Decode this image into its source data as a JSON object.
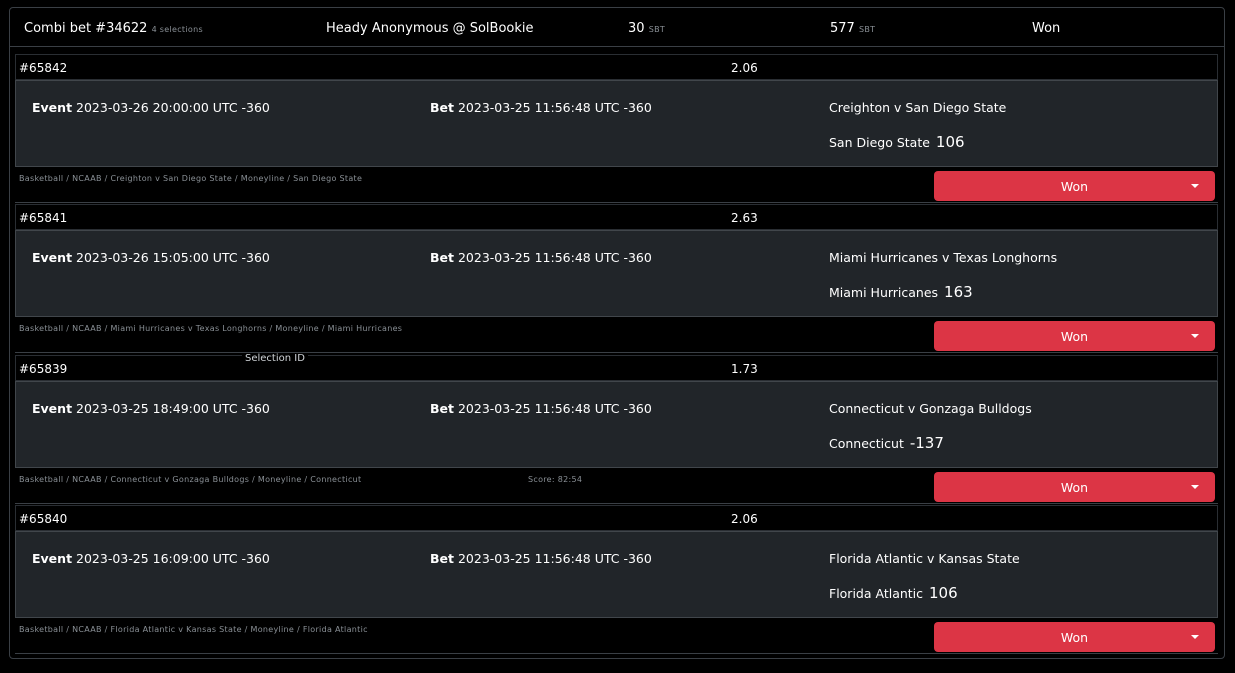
{
  "header": {
    "title": "Combi bet #34622",
    "selections_count": "4 selections",
    "user": "Heady Anonymous @ SolBookie",
    "stake": "30",
    "stake_unit": "SBT",
    "payout": "577",
    "payout_unit": "SBT",
    "status": "Won"
  },
  "tooltip": "Selection ID",
  "labels": {
    "event": "Event",
    "bet": "Bet"
  },
  "selections": [
    {
      "id": "#65842",
      "odds": "2.06",
      "event_time": "2023-03-26 20:00:00 UTC -360",
      "bet_time": "2023-03-25 11:56:48 UTC -360",
      "match": "Creighton v San Diego State",
      "pick": "San Diego State",
      "line": "106",
      "path": "Basketball / NCAAB / Creighton v San Diego State / Moneyline / San Diego State",
      "score": "",
      "status": "Won"
    },
    {
      "id": "#65841",
      "odds": "2.63",
      "event_time": "2023-03-26 15:05:00 UTC -360",
      "bet_time": "2023-03-25 11:56:48 UTC -360",
      "match": "Miami Hurricanes v Texas Longhorns",
      "pick": "Miami Hurricanes",
      "line": "163",
      "path": "Basketball / NCAAB / Miami Hurricanes v Texas Longhorns / Moneyline / Miami Hurricanes",
      "score": "",
      "status": "Won"
    },
    {
      "id": "#65839",
      "odds": "1.73",
      "event_time": "2023-03-25 18:49:00 UTC -360",
      "bet_time": "2023-03-25 11:56:48 UTC -360",
      "match": "Connecticut v Gonzaga Bulldogs",
      "pick": "Connecticut",
      "line": "-137",
      "path": "Basketball / NCAAB / Connecticut v Gonzaga Bulldogs / Moneyline / Connecticut",
      "score": "Score: 82:54",
      "status": "Won"
    },
    {
      "id": "#65840",
      "odds": "2.06",
      "event_time": "2023-03-25 16:09:00 UTC -360",
      "bet_time": "2023-03-25 11:56:48 UTC -360",
      "match": "Florida Atlantic v Kansas State",
      "pick": "Florida Atlantic",
      "line": "106",
      "path": "Basketball / NCAAB / Florida Atlantic v Kansas State / Moneyline / Florida Atlantic",
      "score": "",
      "status": "Won"
    }
  ],
  "colors": {
    "status_won": "#dc3545",
    "panel": "#212529",
    "background": "#000000"
  }
}
